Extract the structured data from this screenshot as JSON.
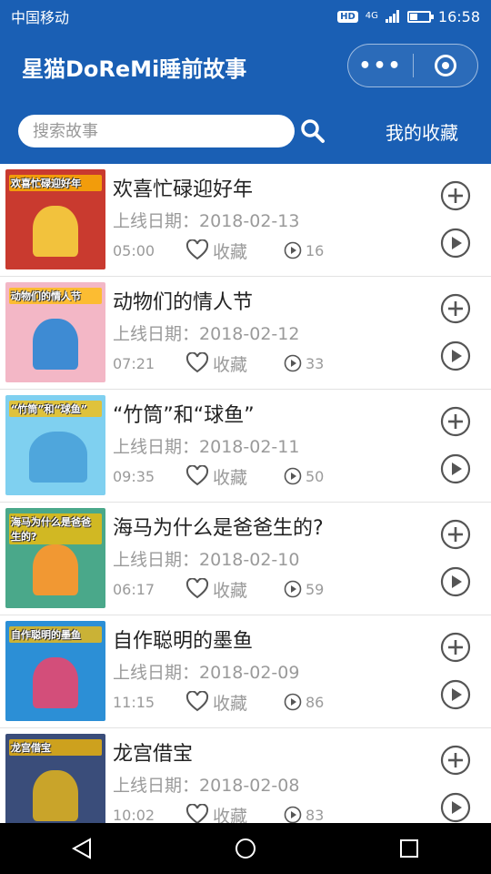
{
  "status_bar": {
    "carrier": "中国移动",
    "hd_badge": "HD",
    "signal_badge": "4G",
    "time": "16:58"
  },
  "title_bar": {
    "app_title": "星猫DoReMi睡前故事",
    "more_label": "•••"
  },
  "search": {
    "placeholder": "搜索故事",
    "favorites_link": "我的收藏"
  },
  "stories": [
    {
      "title": "欢喜忙碌迎好年",
      "date_label": "上线日期：",
      "date": "2018-02-13",
      "duration": "05:00",
      "fav_label": "收藏",
      "plays": "16",
      "thumb_caption": "欢喜忙碌迎好年"
    },
    {
      "title": "动物们的情人节",
      "date_label": "上线日期：",
      "date": "2018-02-12",
      "duration": "07:21",
      "fav_label": "收藏",
      "plays": "33",
      "thumb_caption": "动物们的情人节"
    },
    {
      "title": "“竹筒”和“球鱼”",
      "date_label": "上线日期：",
      "date": "2018-02-11",
      "duration": "09:35",
      "fav_label": "收藏",
      "plays": "50",
      "thumb_caption": "“竹筒”和“球鱼”"
    },
    {
      "title": "海马为什么是爸爸生的?",
      "date_label": "上线日期：",
      "date": "2018-02-10",
      "duration": "06:17",
      "fav_label": "收藏",
      "plays": "59",
      "thumb_caption": "海马为什么是爸爸生的?"
    },
    {
      "title": "自作聪明的墨鱼",
      "date_label": "上线日期：",
      "date": "2018-02-09",
      "duration": "11:15",
      "fav_label": "收藏",
      "plays": "86",
      "thumb_caption": "自作聪明的墨鱼"
    },
    {
      "title": "龙宫借宝",
      "date_label": "上线日期：",
      "date": "2018-02-08",
      "duration": "10:02",
      "fav_label": "收藏",
      "plays": "83",
      "thumb_caption": "龙宫借宝"
    }
  ],
  "colors": {
    "header_bg": "#1a5fb4",
    "text_secondary": "#9a9a9a",
    "icon_gray": "#555555"
  }
}
